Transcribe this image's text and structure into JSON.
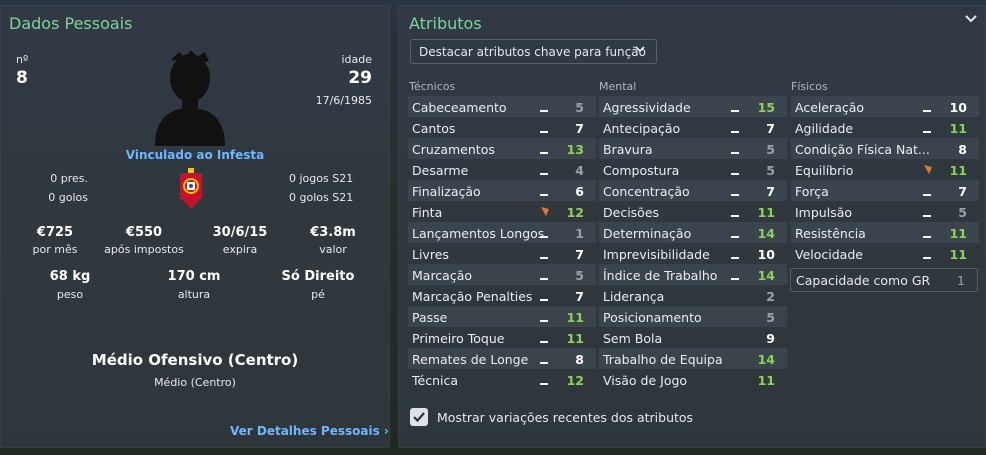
{
  "left": {
    "title": "Dados Pessoais",
    "number_label": "nº",
    "number": "8",
    "age_label": "idade",
    "age": "29",
    "birth_date": "17/6/1985",
    "club_status": "Vinculado ao Infesta",
    "intl_caps_left": "0 pres.",
    "intl_goals_left": "0 golos",
    "youth_caps": "0 jogos S21",
    "youth_goals": "0 golos S21",
    "finance": [
      {
        "value": "€725",
        "label": "por mês"
      },
      {
        "value": "€550",
        "label": "após impostos"
      },
      {
        "value": "30/6/15",
        "label": "expira"
      },
      {
        "value": "€3.8m",
        "label": "valor"
      }
    ],
    "physical": [
      {
        "value": "68 kg",
        "label": "peso"
      },
      {
        "value": "170 cm",
        "label": "altura"
      },
      {
        "value": "Só Direito",
        "label": "pé"
      }
    ],
    "position_main": "Médio Ofensivo (Centro)",
    "position_sub": "Médio (Centro)",
    "details_link": "Ver Detalhes Pessoais"
  },
  "right": {
    "title": "Atributos",
    "dropdown_label": "Destacar atributos chave para função",
    "col_headers": [
      "Técnicos",
      "Mental",
      "Físicos"
    ],
    "technical": [
      {
        "name": "Cabeceamento",
        "trend": "flat",
        "value": "5"
      },
      {
        "name": "Cantos",
        "trend": "flat",
        "value": "7"
      },
      {
        "name": "Cruzamentos",
        "trend": "flat",
        "value": "13"
      },
      {
        "name": "Desarme",
        "trend": "flat",
        "value": "4"
      },
      {
        "name": "Finalização",
        "trend": "flat",
        "value": "6"
      },
      {
        "name": "Finta",
        "trend": "down",
        "value": "12"
      },
      {
        "name": "Lançamentos Longos",
        "trend": "flat",
        "value": "1"
      },
      {
        "name": "Livres",
        "trend": "flat",
        "value": "7"
      },
      {
        "name": "Marcação",
        "trend": "flat",
        "value": "5"
      },
      {
        "name": "Marcação Penalties",
        "trend": "flat",
        "value": "7"
      },
      {
        "name": "Passe",
        "trend": "flat",
        "value": "11"
      },
      {
        "name": "Primeiro Toque",
        "trend": "flat",
        "value": "11"
      },
      {
        "name": "Remates de Longe",
        "trend": "flat",
        "value": "8"
      },
      {
        "name": "Técnica",
        "trend": "flat",
        "value": "12"
      }
    ],
    "mental": [
      {
        "name": "Agressividade",
        "trend": "flat",
        "value": "15"
      },
      {
        "name": "Antecipação",
        "trend": "flat",
        "value": "7"
      },
      {
        "name": "Bravura",
        "trend": "flat",
        "value": "5"
      },
      {
        "name": "Compostura",
        "trend": "flat",
        "value": "5"
      },
      {
        "name": "Concentração",
        "trend": "flat",
        "value": "7"
      },
      {
        "name": "Decisões",
        "trend": "flat",
        "value": "11"
      },
      {
        "name": "Determinação",
        "trend": "flat",
        "value": "14"
      },
      {
        "name": "Imprevisibilidade",
        "trend": "flat",
        "value": "10"
      },
      {
        "name": "Índice de Trabalho",
        "trend": "flat",
        "value": "14"
      },
      {
        "name": "Liderança",
        "trend": "none",
        "value": "2"
      },
      {
        "name": "Posicionamento",
        "trend": "none",
        "value": "5"
      },
      {
        "name": "Sem Bola",
        "trend": "none",
        "value": "9"
      },
      {
        "name": "Trabalho de Equipa",
        "trend": "none",
        "value": "14"
      },
      {
        "name": "Visão de Jogo",
        "trend": "none",
        "value": "11"
      }
    ],
    "physical": [
      {
        "name": "Aceleração",
        "trend": "flat",
        "value": "10"
      },
      {
        "name": "Agilidade",
        "trend": "flat",
        "value": "11"
      },
      {
        "name": "Condição Física Nat...",
        "trend": "none",
        "value": "8"
      },
      {
        "name": "Equilíbrio",
        "trend": "down",
        "value": "11"
      },
      {
        "name": "Força",
        "trend": "flat",
        "value": "7"
      },
      {
        "name": "Impulsão",
        "trend": "flat",
        "value": "5"
      },
      {
        "name": "Resistência",
        "trend": "flat",
        "value": "11"
      },
      {
        "name": "Velocidade",
        "trend": "flat",
        "value": "11"
      }
    ],
    "gk_label": "Capacidade como GR",
    "gk_value": "1",
    "checkbox_label": "Mostrar variações recentes dos atributos"
  }
}
